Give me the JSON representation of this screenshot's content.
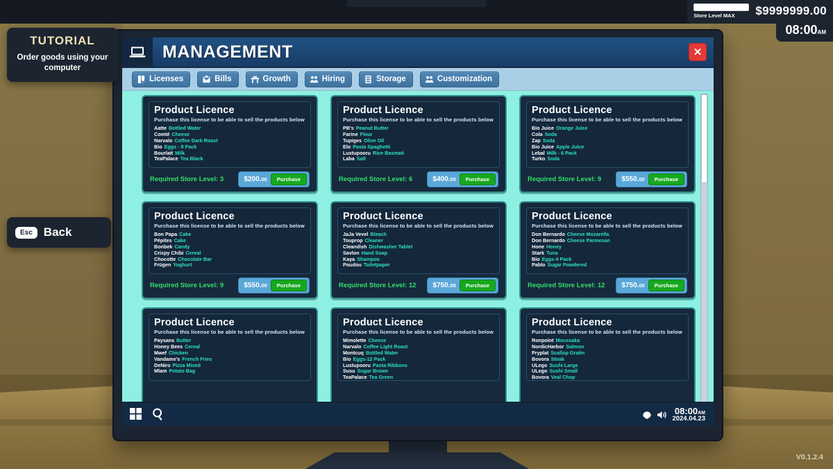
{
  "hud": {
    "tutorial_title": "TUTORIAL",
    "tutorial_text": "Order goods using your computer",
    "back_key": "Esc",
    "back_label": "Back",
    "store_level": "Store Level MAX",
    "money": "$9999999.00",
    "clock": "08:00",
    "clock_suffix": "AM",
    "version": "V0.1.2.4"
  },
  "window": {
    "title": "MANAGEMENT",
    "close_label": "✕",
    "icon": "laptop-icon"
  },
  "tabs": [
    {
      "label": "Licenses",
      "icon": "license-icon"
    },
    {
      "label": "Bills",
      "icon": "envelope-icon"
    },
    {
      "label": "Growth",
      "icon": "counter-icon"
    },
    {
      "label": "Hiring",
      "icon": "people-icon"
    },
    {
      "label": "Storage",
      "icon": "shelf-icon"
    },
    {
      "label": "Customization",
      "icon": "people-paint-icon"
    }
  ],
  "taskbar": {
    "start_icon": "grid-icon",
    "search_icon": "search-icon",
    "wifi_icon": "wifi-icon",
    "volume_icon": "volume-icon",
    "time": "08:00",
    "time_suffix": "AM",
    "date": "2024.04.23"
  },
  "card_defaults": {
    "title": "Product Licence",
    "subtitle": "Purchase this license to be able to sell the products below",
    "buy_label": "Purchase",
    "level_prefix": "Required Store Level: "
  },
  "cards": [
    {
      "title": "Product Licence",
      "subtitle": "Purchase this license to be able to sell the products below",
      "level": "Required Store Level: 3",
      "price_main": "$200.",
      "price_cents": "00",
      "buy_label": "Purchase",
      "products": [
        {
          "brand": "Aatte",
          "name": "Bottled Water"
        },
        {
          "brand": "Comté",
          "name": "Cheese"
        },
        {
          "brand": "Narvalo",
          "name": "Coffee Dark Roast"
        },
        {
          "brand": "Bio",
          "name": "Eggs - 8 Pack"
        },
        {
          "brand": "Bourlait",
          "name": "Milk"
        },
        {
          "brand": "TeaPalace",
          "name": "Tea Black"
        }
      ]
    },
    {
      "title": "Product Licence",
      "subtitle": "Purchase this license to be able to sell the products below",
      "level": "Required Store Level: 6",
      "price_main": "$400.",
      "price_cents": "00",
      "buy_label": "Purchase",
      "products": [
        {
          "brand": "PB's",
          "name": "Peanut Butter"
        },
        {
          "brand": "Farine",
          "name": "Flour"
        },
        {
          "brand": "Tupiges",
          "name": "Olive Oil"
        },
        {
          "brand": "Elo",
          "name": "Pasta Spaghetti"
        },
        {
          "brand": "Lustupooru",
          "name": "Rice Basmati"
        },
        {
          "brand": "Laba",
          "name": "Salt"
        }
      ]
    },
    {
      "title": "Product Licence",
      "subtitle": "Purchase this license to be able to sell the products below",
      "level": "Required Store Level: 9",
      "price_main": "$550.",
      "price_cents": "00",
      "buy_label": "Purchase",
      "products": [
        {
          "brand": "Bio Juice",
          "name": "Orange Juice"
        },
        {
          "brand": "Cola",
          "name": "Soda"
        },
        {
          "brand": "Zap",
          "name": "Soda"
        },
        {
          "brand": "Bio Juice",
          "name": "Apple Juice"
        },
        {
          "brand": "Lebal",
          "name": "Milk - 6 Pack"
        },
        {
          "brand": "Turko",
          "name": "Soda"
        }
      ]
    },
    {
      "title": "Product Licence",
      "subtitle": "Purchase this license to be able to sell the products below",
      "level": "Required Store Level: 9",
      "price_main": "$550.",
      "price_cents": "00",
      "buy_label": "Purchase",
      "products": [
        {
          "brand": "Bon Papa",
          "name": "Cake"
        },
        {
          "brand": "Pépites",
          "name": "Cake"
        },
        {
          "brand": "Bonbek",
          "name": "Candy"
        },
        {
          "brand": "Crispy Chibi",
          "name": "Cereal"
        },
        {
          "brand": "Chocotte",
          "name": "Chocolate Bar"
        },
        {
          "brand": "Frügen",
          "name": "Yoghurt"
        }
      ]
    },
    {
      "title": "Product Licence",
      "subtitle": "Purchase this license to be able to sell the products below",
      "level": "Required Store Level: 12",
      "price_main": "$750.",
      "price_cents": "00",
      "buy_label": "Purchase",
      "products": [
        {
          "brand": "JaJa Vevel",
          "name": "Bleach"
        },
        {
          "brand": "Touprop",
          "name": "Cleaner"
        },
        {
          "brand": "Cleandish",
          "name": "Dishwasher Tablet"
        },
        {
          "brand": "Savlon",
          "name": "Hand Soap"
        },
        {
          "brand": "Kaya",
          "name": "Shampoo"
        },
        {
          "brand": "Poudou",
          "name": "Toiletpaper"
        }
      ]
    },
    {
      "title": "Product Licence",
      "subtitle": "Purchase this license to be able to sell the products below",
      "level": "Required Store Level: 12",
      "price_main": "$750.",
      "price_cents": "00",
      "buy_label": "Purchase",
      "products": [
        {
          "brand": "Don Bernardo",
          "name": "Cheese Mozarella"
        },
        {
          "brand": "Don Bernardo",
          "name": "Cheese Parmesan"
        },
        {
          "brand": "Hone",
          "name": "Honey"
        },
        {
          "brand": "Stark",
          "name": "Tuna"
        },
        {
          "brand": "Bio",
          "name": "Eggs-4 Pack"
        },
        {
          "brand": "Pablo",
          "name": "Sugar Powdered"
        }
      ]
    },
    {
      "title": "Product Licence",
      "subtitle": "Purchase this license to be able to sell the products below",
      "level": "",
      "price_main": "",
      "price_cents": "",
      "buy_label": "",
      "products": [
        {
          "brand": "Paysans",
          "name": "Butter"
        },
        {
          "brand": "Honey Bees",
          "name": "Cereal"
        },
        {
          "brand": "Mwef",
          "name": "Chicken"
        },
        {
          "brand": "Vandame's",
          "name": "French Fries"
        },
        {
          "brand": "DeNiro",
          "name": "Pizza Mixed"
        },
        {
          "brand": "Mlam",
          "name": "Potato Bag"
        }
      ]
    },
    {
      "title": "Product Licence",
      "subtitle": "Purchase this license to be able to sell the products below",
      "level": "",
      "price_main": "",
      "price_cents": "",
      "buy_label": "",
      "products": [
        {
          "brand": "Mimolette",
          "name": "Cheese"
        },
        {
          "brand": "Narvalo",
          "name": "Coffee Light Roast"
        },
        {
          "brand": "Montcuq",
          "name": "Bottled Water"
        },
        {
          "brand": "Bio",
          "name": "Eggs-12 Pack"
        },
        {
          "brand": "Lustupooru",
          "name": "Pasta Ribbons"
        },
        {
          "brand": "Susu",
          "name": "Sugar Brown"
        },
        {
          "brand": "TeaPalace",
          "name": "Tea Green"
        }
      ]
    },
    {
      "title": "Product Licence",
      "subtitle": "Purchase this license to be able to sell the products below",
      "level": "",
      "price_main": "",
      "price_cents": "",
      "buy_label": "",
      "products": [
        {
          "brand": "Ronpoint",
          "name": "Moussaka"
        },
        {
          "brand": "NordicHarbor",
          "name": "Salmon"
        },
        {
          "brand": "Pryplat",
          "name": "Scallop Gratin"
        },
        {
          "brand": "Bovora",
          "name": "Steak"
        },
        {
          "brand": "ULego",
          "name": "Sushi Large"
        },
        {
          "brand": "ULego",
          "name": "Sushi Small"
        },
        {
          "brand": "Bovora",
          "name": "Veal Chop"
        }
      ]
    }
  ],
  "colors": {
    "accent_teal": "#2fe0c0",
    "content_bg": "#8ef0e2",
    "card_bg": "#17293c",
    "titlebar": "#1c4573",
    "buy_green": "#17a81f",
    "level_green": "#31e06b",
    "close_red": "#e53935"
  }
}
